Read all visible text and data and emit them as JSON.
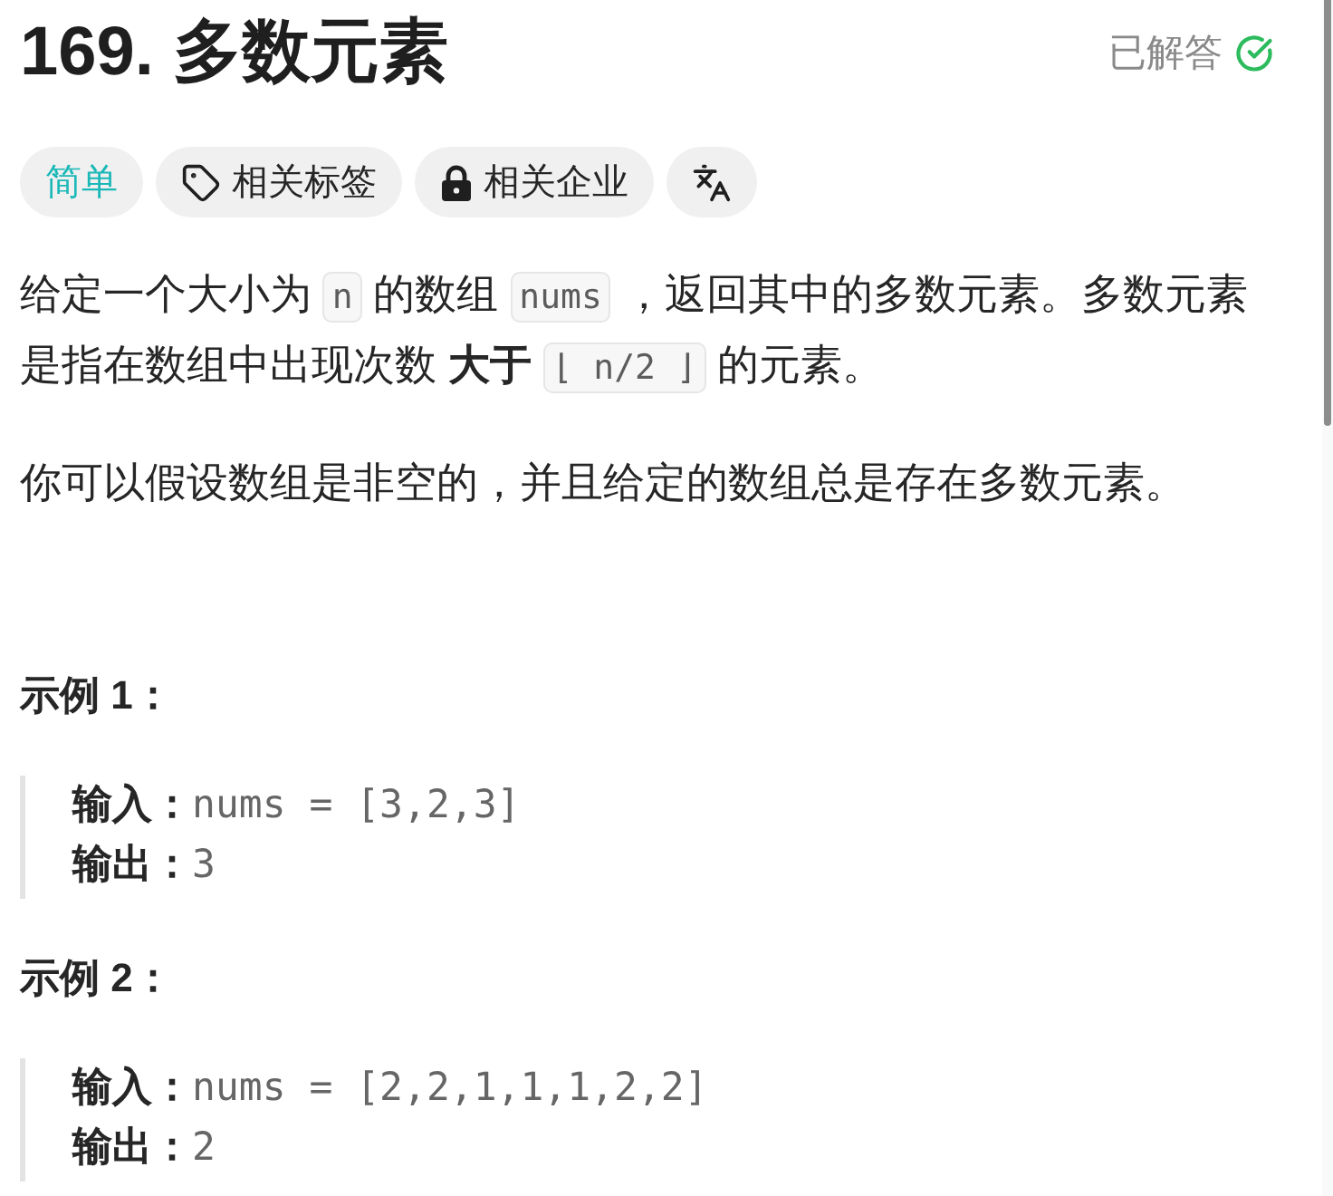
{
  "header": {
    "title": "169. 多数元素",
    "status": "已解答"
  },
  "tags": [
    {
      "kind": "difficulty",
      "label": "简单"
    },
    {
      "kind": "topics",
      "label": "相关标签"
    },
    {
      "kind": "companies",
      "label": "相关企业"
    },
    {
      "kind": "translate"
    }
  ],
  "description": [
    [
      {
        "kind": "text",
        "text": "给定一个大小为 "
      },
      {
        "kind": "code",
        "text": "n"
      },
      {
        "kind": "text",
        "text": " 的数组 "
      },
      {
        "kind": "code",
        "text": "nums"
      },
      {
        "kind": "text",
        "text": " ，返回其中的多数元素。多数元素是指在数组中出现次数 **大于** "
      },
      {
        "kind": "code",
        "text": "⌊ n/2 ⌋"
      },
      {
        "kind": "text",
        "text": " 的元素。"
      }
    ],
    [
      {
        "kind": "text",
        "text": "你可以假设数组是非空的，并且给定的数组总是存在多数元素。"
      }
    ]
  ],
  "examples": [
    {
      "title": "示例 1：",
      "lines": [
        {
          "label": "输入：",
          "value": "nums = [3,2,3]"
        },
        {
          "label": "输出：",
          "value": "3"
        }
      ]
    },
    {
      "title": "示例 2：",
      "lines": [
        {
          "label": "输入：",
          "value": "nums = [2,2,1,1,1,2,2]"
        },
        {
          "label": "输出：",
          "value": "2"
        }
      ]
    }
  ]
}
